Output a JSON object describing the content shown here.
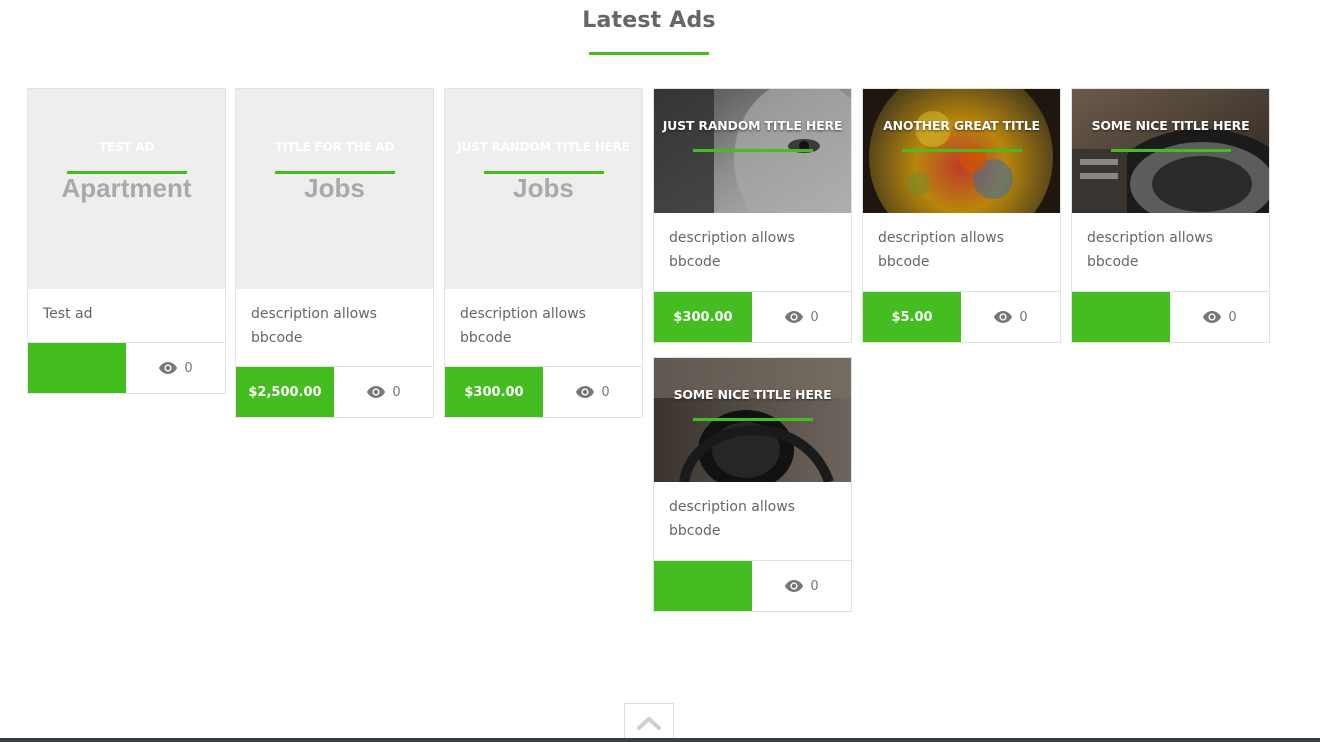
{
  "section": {
    "title": "Latest Ads"
  },
  "cards": [
    {
      "title": "TEST AD",
      "category": "Apartment",
      "description": "Test ad",
      "price": "",
      "views": "0",
      "image": "placeholder"
    },
    {
      "title": "TITLE FOR THE AD",
      "category": "Jobs",
      "description": "description allows bbcode",
      "price": "$2,500.00",
      "views": "0",
      "image": "placeholder"
    },
    {
      "title": "JUST RANDOM TITLE HERE",
      "category": "Jobs",
      "description": "description allows bbcode",
      "price": "$300.00",
      "views": "0",
      "image": "placeholder"
    },
    {
      "title": "JUST RANDOM TITLE HERE",
      "description": "description allows bbcode",
      "price": "$300.00",
      "views": "0",
      "image": "photo-face"
    },
    {
      "title": "ANOTHER GREAT TITLE",
      "description": "description allows bbcode",
      "price": "$5.00",
      "views": "0",
      "image": "photo-glass"
    },
    {
      "title": "SOME NICE TITLE HERE",
      "description": "description allows bbcode",
      "price": "",
      "views": "0",
      "image": "photo-turntable"
    },
    {
      "title": "SOME NICE TITLE HERE",
      "description": "description allows bbcode",
      "price": "",
      "views": "0",
      "image": "photo-headphones"
    }
  ],
  "colors": {
    "accent": "#43bd1f",
    "placeholder_bg": "#eeeeee",
    "footer": "#3b3e40"
  },
  "icons": {
    "views": "eye-icon",
    "back_to_top": "chevron-up-icon"
  }
}
